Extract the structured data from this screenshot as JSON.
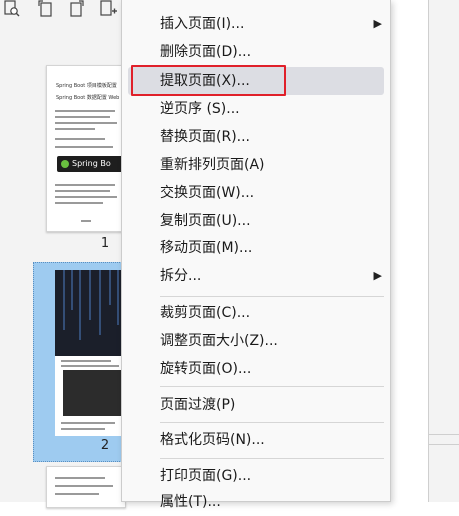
{
  "toolbar": {
    "icons": [
      "zoom-page-icon",
      "rotate-left-icon",
      "rotate-right-icon",
      "insert-page-icon"
    ]
  },
  "thumbnails": [
    {
      "page_label": "1",
      "title1": "Spring Boot 项目模板配置",
      "title2": "Spring Boot 数据配置 Web",
      "badge": "Spring Bo"
    },
    {
      "page_label": "2"
    }
  ],
  "context_menu": {
    "items": [
      {
        "label": "插入页面(I)...",
        "submenu": true
      },
      {
        "label": "删除页面(D)..."
      },
      {
        "label": "提取页面(X)...",
        "highlighted": true
      },
      {
        "label": "逆页序 (S)..."
      },
      {
        "label": "替换页面(R)..."
      },
      {
        "label": "重新排列页面(A)"
      },
      {
        "label": "交换页面(W)..."
      },
      {
        "label": "复制页面(U)..."
      },
      {
        "label": "移动页面(M)..."
      },
      {
        "label": "拆分...",
        "submenu": true
      },
      {
        "label": "裁剪页面(C)..."
      },
      {
        "label": "调整页面大小(Z)..."
      },
      {
        "label": "旋转页面(O)..."
      },
      {
        "label": "页面过渡(P)"
      },
      {
        "label": "格式化页码(N)..."
      },
      {
        "label": "打印页面(G)..."
      },
      {
        "label": "属性(T)..."
      }
    ],
    "submenu_arrow": "▶"
  },
  "colors": {
    "highlight": "#dcdde3",
    "annotation_box": "#e0202a",
    "selected_thumb": "#9ecbf0"
  }
}
